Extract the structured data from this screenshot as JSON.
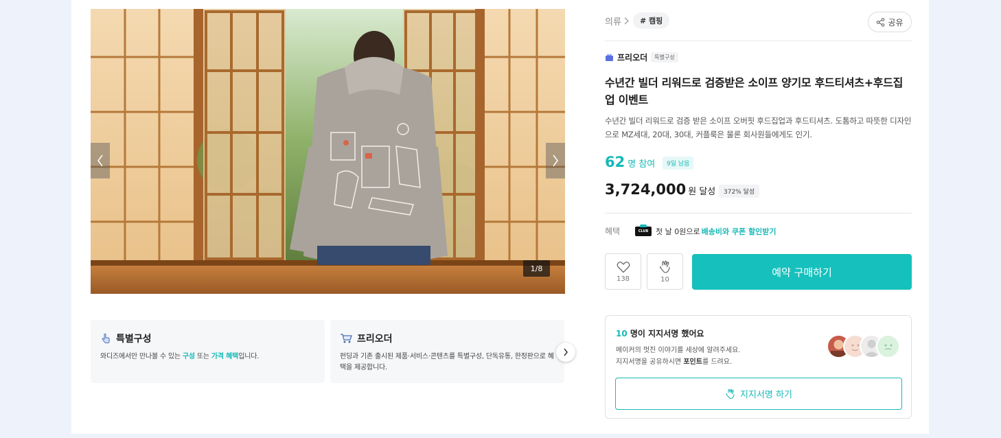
{
  "gallery": {
    "counter": "1/8",
    "prev_icon": "chevron-left-icon",
    "next_icon": "chevron-right-icon"
  },
  "features": [
    {
      "title": "특별구성",
      "icon": "hand-pointer-icon",
      "desc_pre": "와디즈에서만 만나볼 수 있는 ",
      "desc_hl1": "구성",
      "desc_mid": " 또는 ",
      "desc_hl2": "가격 혜택",
      "desc_post": "입니다."
    },
    {
      "title": "프리오더",
      "icon": "cart-icon",
      "desc": "펀딩과 기존 출시된 제품·서비스·콘텐츠를 특별구성, 단독유통, 한정판으로 혜택을 제공합니다."
    }
  ],
  "info": {
    "breadcrumb": "의류",
    "tag": "# 캠핑",
    "share_label": "공유",
    "maker_name": "프리오더",
    "maker_badge": "특별구성",
    "title": "수년간 빌더 리워드로 검증받은 소이프 양기모 후드티셔츠+후드집업 이벤트",
    "description": "수년간 빌더 리워드로 검증 받은 소이프 오버핏 후드집업과 후드티셔츠. 도톰하고 따뜻한 디자인으로 MZ세대, 20대, 30대, 커플룩은 물론 회사원들에게도 인기.",
    "participants_number": "62",
    "participants_unit": "명 참여",
    "days_left": "9일 남음",
    "amount_number": "3,724,000",
    "amount_unit": "원 달성",
    "achieve_rate": "372% 달성",
    "benefit_label": "혜택",
    "benefit_club": "CLUB",
    "benefit_text": "첫 날 0원으로",
    "benefit_link": "배송비와 쿠폰 할인받기",
    "like_count": "138",
    "cheer_count": "10",
    "buy_label": "예약 구매하기"
  },
  "support": {
    "count": "10",
    "title_suffix": " 명이 지지서명 했어요",
    "desc_line1": "메이커의 멋진 이야기를 세상에 알려주세요.",
    "desc_line2_pre": "지지서명을 공유하시면 ",
    "desc_line2_hl": "포인트",
    "desc_line2_post": "를 드려요.",
    "button_label": "지지서명 하기"
  },
  "colors": {
    "accent": "#16c0bc",
    "accent_text": "#16b9b6",
    "background": "#eef3fb"
  }
}
